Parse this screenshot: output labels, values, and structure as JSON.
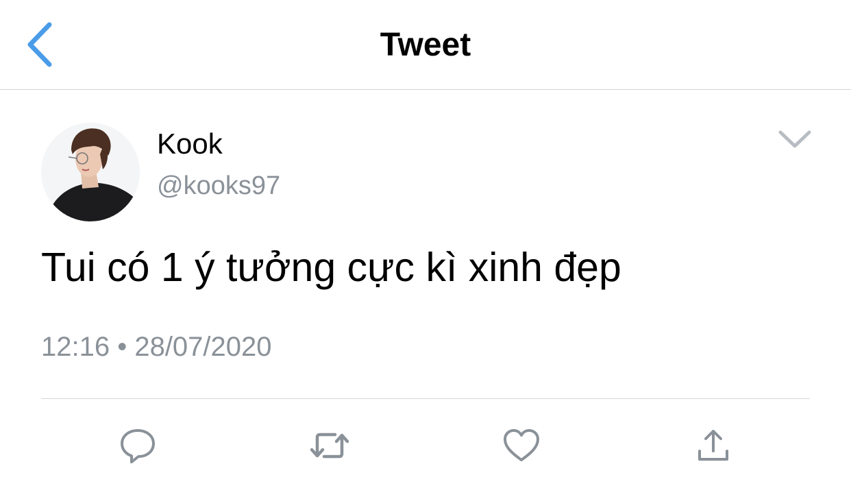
{
  "header": {
    "title": "Tweet",
    "back_icon": "chevron-left-icon"
  },
  "tweet": {
    "author": {
      "display_name": "Kook",
      "handle": "@kooks97",
      "avatar": "profile-photo"
    },
    "text": "Tui có 1 ý tưởng cực kì xinh đẹp",
    "timestamp": "12:16 • 28/07/2020"
  },
  "actions": [
    {
      "name": "reply",
      "icon": "speech-bubble-icon"
    },
    {
      "name": "retweet",
      "icon": "retweet-arrows-icon"
    },
    {
      "name": "like",
      "icon": "heart-icon"
    },
    {
      "name": "share",
      "icon": "share-upload-icon"
    }
  ],
  "colors": {
    "accent": "#4a9ce8",
    "icon_gray": "#8a9198",
    "divider": "#d3d7da"
  }
}
